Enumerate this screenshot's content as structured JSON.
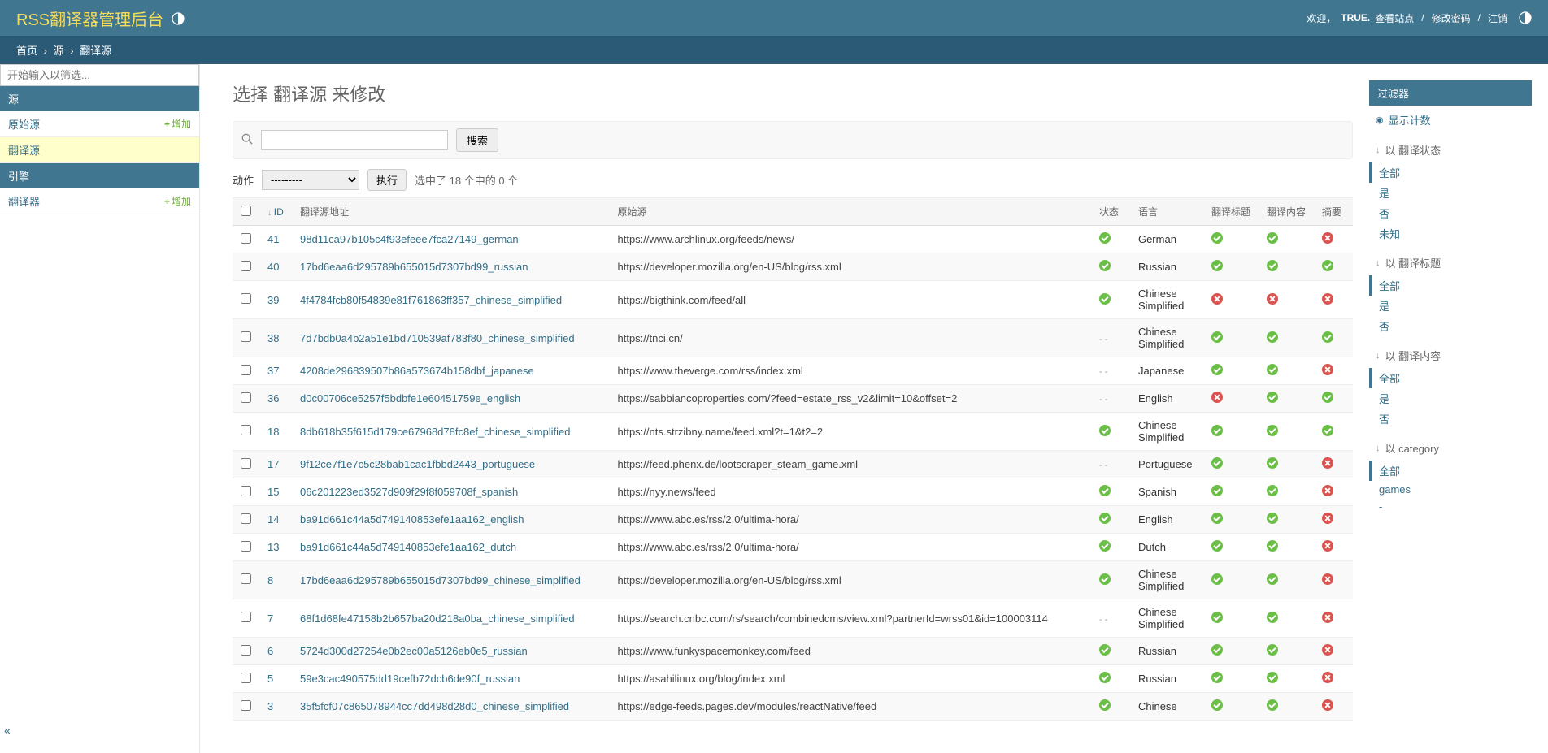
{
  "header": {
    "brand": "RSS翻译器管理后台",
    "welcome": "欢迎，",
    "username": "TRUE.",
    "view_site": "查看站点",
    "change_password": "修改密码",
    "logout": "注销"
  },
  "breadcrumb": {
    "home": "首页",
    "app": "源",
    "model": "翻译源"
  },
  "sidebar": {
    "filter_placeholder": "开始输入以筛选...",
    "groups": [
      {
        "caption": "源",
        "items": [
          {
            "label": "原始源",
            "add": "增加",
            "active": false
          },
          {
            "label": "翻译源",
            "add": "",
            "active": true
          }
        ]
      },
      {
        "caption": "引擎",
        "items": [
          {
            "label": "翻译器",
            "add": "增加",
            "active": false
          }
        ]
      }
    ]
  },
  "page": {
    "title": "选择 翻译源 来修改",
    "search_button": "搜索",
    "action_label": "动作",
    "action_default": "---------",
    "go_button": "执行",
    "selection_text": "选中了 18 个中的 0 个"
  },
  "columns": {
    "id": "ID",
    "addr": "翻译源地址",
    "origin": "原始源",
    "status": "状态",
    "lang": "语言",
    "t_title": "翻译标题",
    "t_content": "翻译内容",
    "summary": "摘要"
  },
  "rows": [
    {
      "id": "41",
      "addr": "98d11ca97b105c4f93efeee7fca27149_german",
      "origin": "https://www.archlinux.org/feeds/news/",
      "status": "yes",
      "lang": "German",
      "t_title": "yes",
      "t_content": "yes",
      "summary": "no"
    },
    {
      "id": "40",
      "addr": "17bd6eaa6d295789b655015d7307bd99_russian",
      "origin": "https://developer.mozilla.org/en-US/blog/rss.xml",
      "status": "yes",
      "lang": "Russian",
      "t_title": "yes",
      "t_content": "yes",
      "summary": "yes"
    },
    {
      "id": "39",
      "addr": "4f4784fcb80f54839e81f761863ff357_chinese_simplified",
      "origin": "https://bigthink.com/feed/all",
      "status": "yes",
      "lang": "Chinese Simplified",
      "t_title": "no",
      "t_content": "no",
      "summary": "no"
    },
    {
      "id": "38",
      "addr": "7d7bdb0a4b2a51e1bd710539af783f80_chinese_simplified",
      "origin": "https://tnci.cn/",
      "status": "dash",
      "lang": "Chinese Simplified",
      "t_title": "yes",
      "t_content": "yes",
      "summary": "yes"
    },
    {
      "id": "37",
      "addr": "4208de296839507b86a573674b158dbf_japanese",
      "origin": "https://www.theverge.com/rss/index.xml",
      "status": "dash",
      "lang": "Japanese",
      "t_title": "yes",
      "t_content": "yes",
      "summary": "no"
    },
    {
      "id": "36",
      "addr": "d0c00706ce5257f5bdbfe1e60451759e_english",
      "origin": "https://sabbiancoproperties.com/?feed=estate_rss_v2&limit=10&offset=2",
      "status": "dash",
      "lang": "English",
      "t_title": "no",
      "t_content": "yes",
      "summary": "yes"
    },
    {
      "id": "18",
      "addr": "8db618b35f615d179ce67968d78fc8ef_chinese_simplified",
      "origin": "https://nts.strzibny.name/feed.xml?t=1&t2=2",
      "status": "yes",
      "lang": "Chinese Simplified",
      "t_title": "yes",
      "t_content": "yes",
      "summary": "yes"
    },
    {
      "id": "17",
      "addr": "9f12ce7f1e7c5c28bab1cac1fbbd2443_portuguese",
      "origin": "https://feed.phenx.de/lootscraper_steam_game.xml",
      "status": "dash",
      "lang": "Portuguese",
      "t_title": "yes",
      "t_content": "yes",
      "summary": "no"
    },
    {
      "id": "15",
      "addr": "06c201223ed3527d909f29f8f059708f_spanish",
      "origin": "https://nyy.news/feed",
      "status": "yes",
      "lang": "Spanish",
      "t_title": "yes",
      "t_content": "yes",
      "summary": "no"
    },
    {
      "id": "14",
      "addr": "ba91d661c44a5d749140853efe1aa162_english",
      "origin": "https://www.abc.es/rss/2,0/ultima-hora/",
      "status": "yes",
      "lang": "English",
      "t_title": "yes",
      "t_content": "yes",
      "summary": "no"
    },
    {
      "id": "13",
      "addr": "ba91d661c44a5d749140853efe1aa162_dutch",
      "origin": "https://www.abc.es/rss/2,0/ultima-hora/",
      "status": "yes",
      "lang": "Dutch",
      "t_title": "yes",
      "t_content": "yes",
      "summary": "no"
    },
    {
      "id": "8",
      "addr": "17bd6eaa6d295789b655015d7307bd99_chinese_simplified",
      "origin": "https://developer.mozilla.org/en-US/blog/rss.xml",
      "status": "yes",
      "lang": "Chinese Simplified",
      "t_title": "yes",
      "t_content": "yes",
      "summary": "no"
    },
    {
      "id": "7",
      "addr": "68f1d68fe47158b2b657ba20d218a0ba_chinese_simplified",
      "origin": "https://search.cnbc.com/rs/search/combinedcms/view.xml?partnerId=wrss01&id=100003114",
      "status": "dash",
      "lang": "Chinese Simplified",
      "t_title": "yes",
      "t_content": "yes",
      "summary": "no"
    },
    {
      "id": "6",
      "addr": "5724d300d27254e0b2ec00a5126eb0e5_russian",
      "origin": "https://www.funkyspacemonkey.com/feed",
      "status": "yes",
      "lang": "Russian",
      "t_title": "yes",
      "t_content": "yes",
      "summary": "no"
    },
    {
      "id": "5",
      "addr": "59e3cac490575dd19cefb72dcb6de90f_russian",
      "origin": "https://asahilinux.org/blog/index.xml",
      "status": "yes",
      "lang": "Russian",
      "t_title": "yes",
      "t_content": "yes",
      "summary": "no"
    },
    {
      "id": "3",
      "addr": "35f5fcf07c865078944cc7dd498d28d0_chinese_simplified",
      "origin": "https://edge-feeds.pages.dev/modules/reactNative/feed",
      "status": "yes",
      "lang": "Chinese",
      "t_title": "yes",
      "t_content": "yes",
      "summary": "no"
    }
  ],
  "filters": {
    "caption": "过滤器",
    "toggle_counts": "显示计数",
    "by_status": {
      "title": "以 翻译状态",
      "options": [
        "全部",
        "是",
        "否",
        "未知"
      ],
      "selected": 0
    },
    "by_title": {
      "title": "以 翻译标题",
      "options": [
        "全部",
        "是",
        "否"
      ],
      "selected": 0
    },
    "by_content": {
      "title": "以 翻译内容",
      "options": [
        "全部",
        "是",
        "否"
      ],
      "selected": 0
    },
    "by_category": {
      "title": "以 category",
      "options": [
        "全部",
        "games",
        "-"
      ],
      "selected": 0
    }
  }
}
